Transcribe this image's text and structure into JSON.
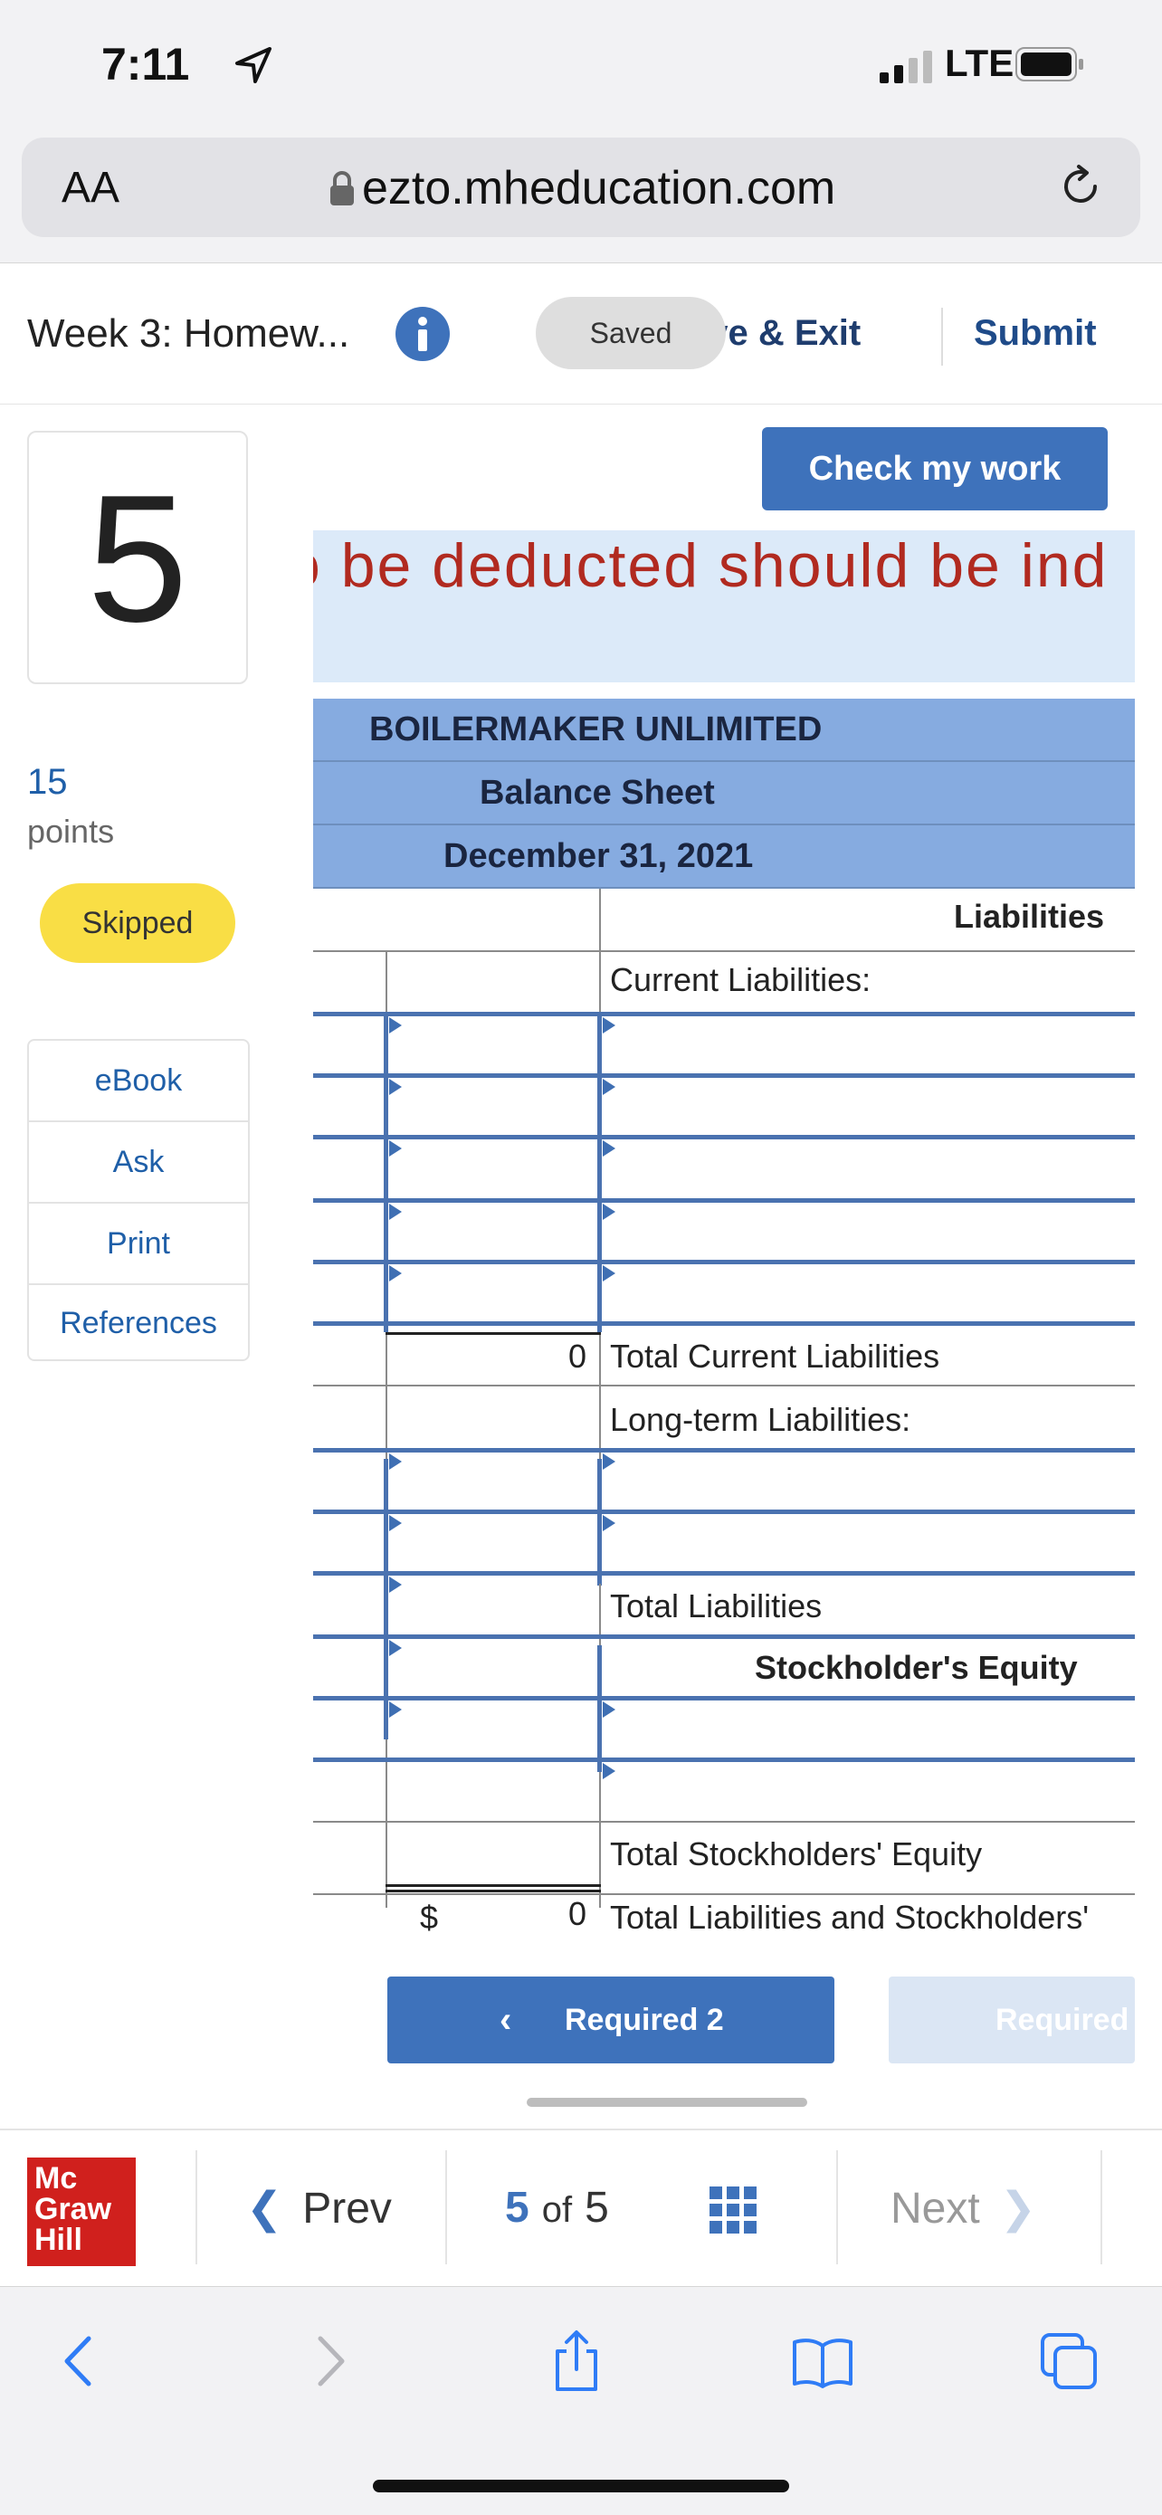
{
  "status_bar": {
    "time": "7:11",
    "network": "LTE"
  },
  "browser": {
    "text_size_button": "AA",
    "url": "ezto.mheducation.com"
  },
  "header": {
    "assignment_title": "Week 3: Homew...",
    "saved_label": "Saved",
    "save_exit_label": "ave & Exit",
    "submit_label": "Submit"
  },
  "question": {
    "number": "5",
    "points_value": "15",
    "points_label": "points",
    "status": "Skipped"
  },
  "tools": [
    "eBook",
    "Ask",
    "Print",
    "References"
  ],
  "check_work_label": "Check my work",
  "instruction_text": "o be deducted should be ind",
  "balance_sheet": {
    "company": "BOILERMAKER UNLIMITED",
    "statement": "Balance Sheet",
    "date": "December 31, 2021",
    "liabilities_header": "Liabilities",
    "current_liabilities_label": "Current Liabilities:",
    "total_current_liabilities_value": "0",
    "total_current_liabilities_label": "Total Current Liabilities",
    "long_term_label": "Long-term Liabilities:",
    "total_liabilities_label": "Total Liabilities",
    "equity_header": "Stockholder's Equity",
    "total_equity_label": "Total Stockholders' Equity",
    "currency_symbol": "$",
    "total_liab_equity_value": "0",
    "total_liab_equity_label": "Total Liabilities and Stockholders'"
  },
  "required_nav": {
    "prev_label": "Required 2",
    "next_label": "Required"
  },
  "footer": {
    "logo_lines": [
      "Mc",
      "Graw",
      "Hill"
    ],
    "prev_label": "Prev",
    "current_page": "5",
    "of_label": "of",
    "total_pages": "5",
    "next_label": "Next"
  },
  "colors": {
    "accent": "#3e72bb",
    "header_blue": "#86abe0",
    "skipped": "#f9de45",
    "instruction_red": "#b12a20"
  }
}
